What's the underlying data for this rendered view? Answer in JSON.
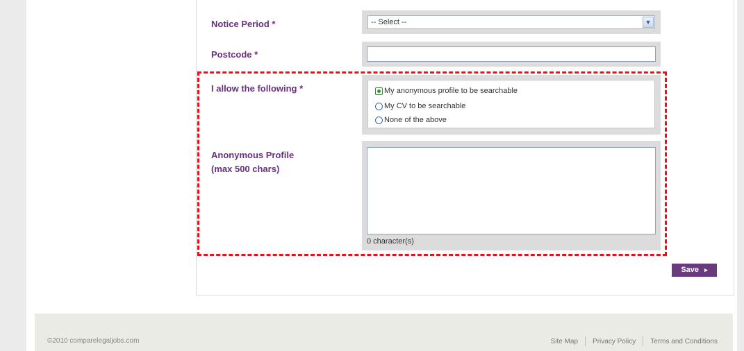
{
  "form": {
    "notice_period_label": "Notice Period *",
    "notice_period_value": "-- Select --",
    "postcode_label": "Postcode *",
    "postcode_value": "",
    "allow_label": "I allow the following *",
    "allow_options": [
      {
        "label": "My anonymous profile to be searchable",
        "checked": true
      },
      {
        "label": "My CV to be searchable",
        "checked": false
      },
      {
        "label": "None of the above",
        "checked": false
      }
    ],
    "profile_label_line1": "Anonymous Profile",
    "profile_label_line2": "(max 500 chars)",
    "profile_value": "",
    "char_count": "0 character(s)",
    "save_label": "Save",
    "save_arrow": "▸"
  },
  "footer": {
    "copyright": "©2010 comparelegaljobs.com",
    "links": [
      "Site Map",
      "Privacy Policy",
      "Terms and Conditions"
    ]
  },
  "colors": {
    "label": "#6a2f7f",
    "highlight": "#e8101a",
    "button": "#6a3a7e"
  }
}
